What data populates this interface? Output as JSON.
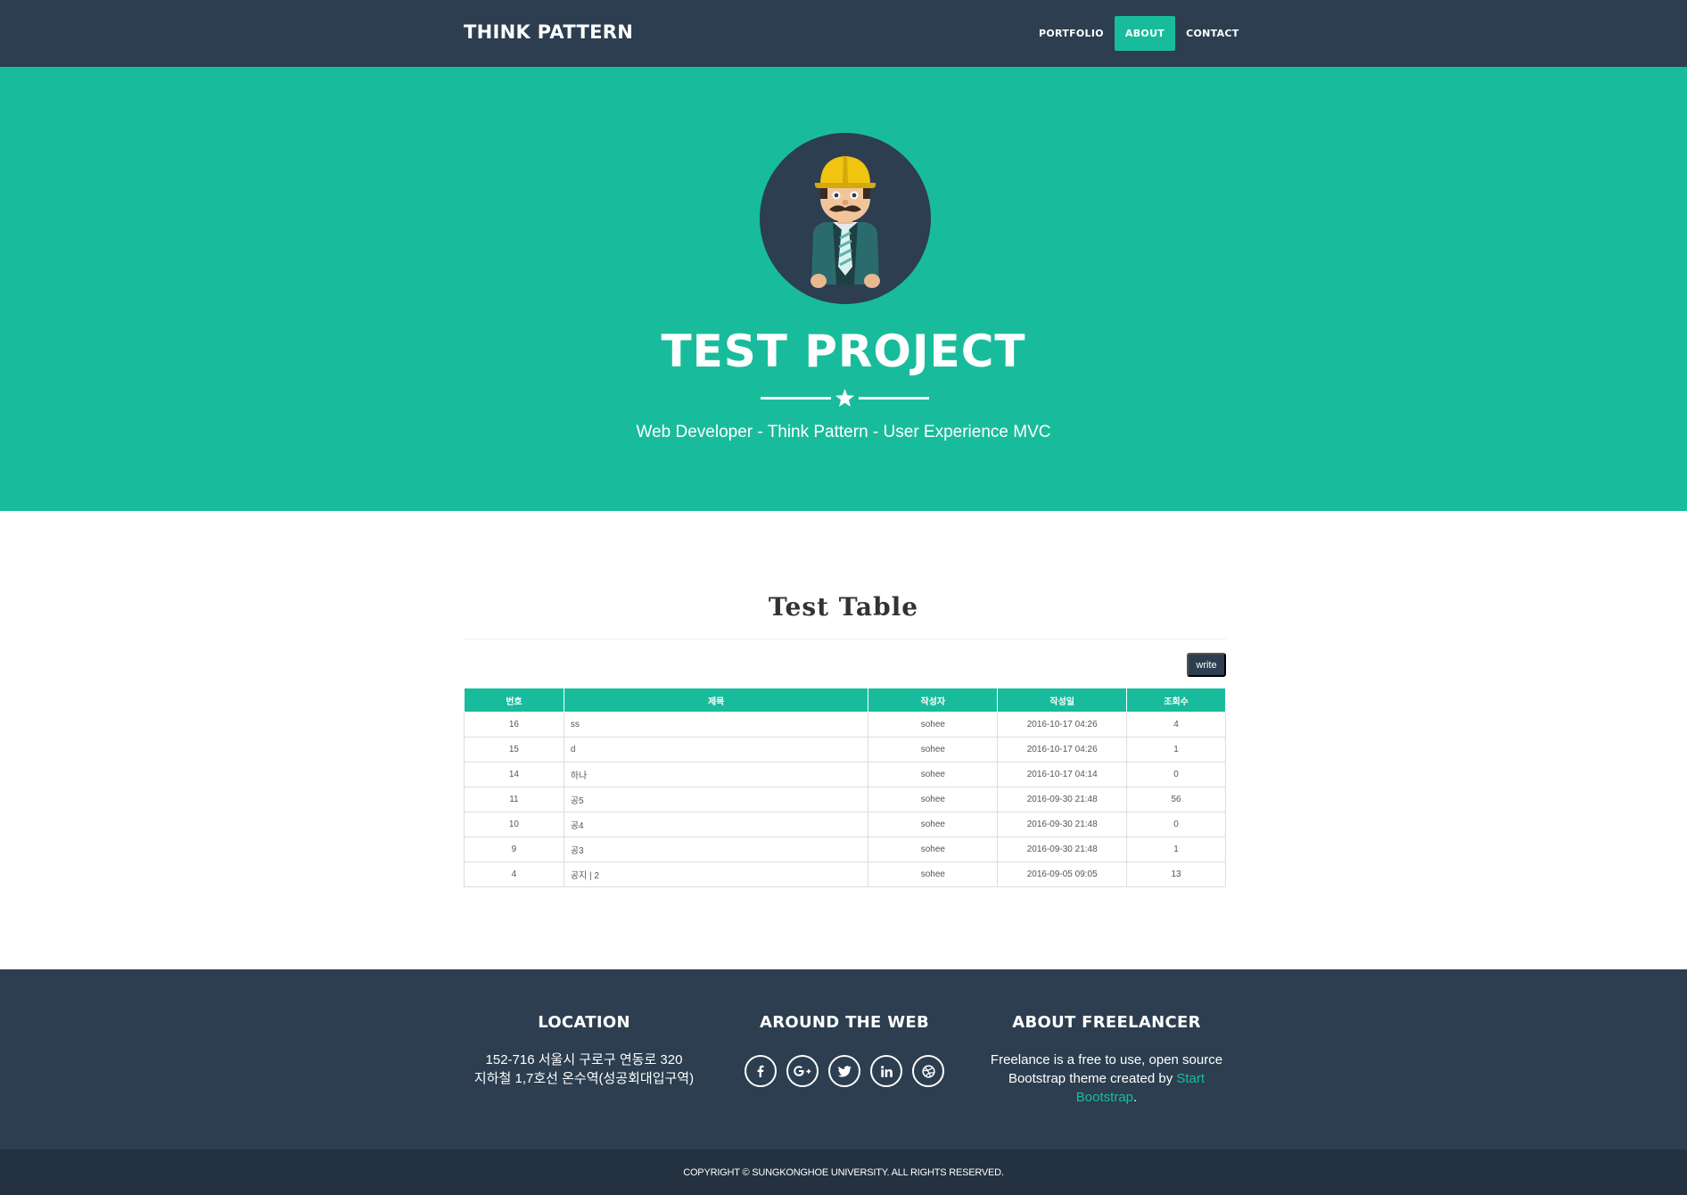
{
  "navbar": {
    "brand": "THINK PATTERN",
    "items": [
      {
        "label": "PORTFOLIO",
        "active": false
      },
      {
        "label": "ABOUT",
        "active": true
      },
      {
        "label": "CONTACT",
        "active": false
      }
    ]
  },
  "hero": {
    "avatar_icon": "construction-worker-avatar",
    "title": "TEST PROJECT",
    "divider_icon": "star-icon",
    "subtitle": "Web Developer - Think Pattern - User Experience MVC"
  },
  "main": {
    "section_title": "Test Table",
    "write_label": "write",
    "table": {
      "headers": [
        "번호",
        "제목",
        "작성자",
        "작성일",
        "조회수"
      ],
      "rows": [
        {
          "num": "16",
          "title": "ss",
          "author": "sohee",
          "date": "2016-10-17 04:26",
          "views": "4"
        },
        {
          "num": "15",
          "title": "d",
          "author": "sohee",
          "date": "2016-10-17 04:26",
          "views": "1"
        },
        {
          "num": "14",
          "title": "하나",
          "author": "sohee",
          "date": "2016-10-17 04:14",
          "views": "0"
        },
        {
          "num": "11",
          "title": "공5",
          "author": "sohee",
          "date": "2016-09-30 21:48",
          "views": "56"
        },
        {
          "num": "10",
          "title": "공4",
          "author": "sohee",
          "date": "2016-09-30 21:48",
          "views": "0"
        },
        {
          "num": "9",
          "title": "공3",
          "author": "sohee",
          "date": "2016-09-30 21:48",
          "views": "1"
        },
        {
          "num": "4",
          "title": "공지 | 2",
          "author": "sohee",
          "date": "2016-09-05 09:05",
          "views": "13"
        }
      ]
    }
  },
  "footer": {
    "location": {
      "heading": "LOCATION",
      "line1": "152-716 서울시 구로구 연동로 320",
      "line2": "지하철 1,7호선 온수역(성공회대입구역)"
    },
    "web": {
      "heading": "AROUND THE WEB",
      "icons": [
        "facebook-icon",
        "google-plus-icon",
        "twitter-icon",
        "linkedin-icon",
        "dribbble-icon"
      ]
    },
    "about": {
      "heading": "ABOUT FREELANCER",
      "text_before": "Freelance is a free to use, open source Bootstrap theme created by ",
      "link": "Start Bootstrap",
      "text_after": "."
    },
    "copyright": "COPYRIGHT © SUNGKONGHOE UNIVERSITY. ALL RIGHTS RESERVED."
  },
  "colors": {
    "primary_dark": "#2c3e50",
    "accent": "#18bc9c",
    "copyright_bg": "#233140"
  }
}
